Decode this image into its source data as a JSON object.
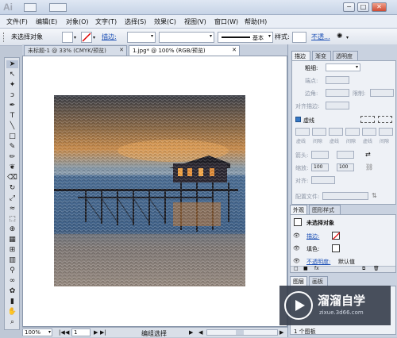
{
  "app": {
    "logo": "Ai"
  },
  "window_controls": {
    "minimize": "−",
    "maximize": "□",
    "close": "✕"
  },
  "menu": [
    "文件(F)",
    "编辑(E)",
    "对象(O)",
    "文字(T)",
    "选择(S)",
    "效果(C)",
    "视图(V)",
    "窗口(W)",
    "帮助(H)"
  ],
  "control_bar": {
    "selection_label": "未选择对象",
    "stroke_link": "描边:",
    "stroke_style": "基本",
    "style_label": "样式:",
    "opacity_link": "不透..."
  },
  "doc_tabs": [
    {
      "label": "未标题-1 @ 33% (CMYK/预览)",
      "close": "✕"
    },
    {
      "label": "1.jpg* @ 100% (RGB/预览)",
      "close": "✕"
    }
  ],
  "status": {
    "zoom": "100%",
    "page": "1",
    "tool": "编组选择"
  },
  "stroke_panel": {
    "tabs": [
      "描边",
      "渐变",
      "透明度"
    ],
    "weight_label": "粗细:",
    "cap_label": "端点:",
    "corner_label": "边角:",
    "limit_label": "限制:",
    "align_label": "对齐描边:",
    "dashed_label": "虚线",
    "arrow_label": "箭头:",
    "scale_label": "缩放:",
    "scale_start": "100",
    "scale_end": "100",
    "arrow_align_label": "对齐:",
    "profile_label": "配置文件:",
    "dash_inputs": [
      "虚线",
      "间隙",
      "虚线",
      "间隙",
      "虚线",
      "间隙"
    ]
  },
  "appearance_panel": {
    "tabs": [
      "外观",
      "图形样式"
    ],
    "title": "未选择对象",
    "rows": [
      {
        "label": "描边:",
        "is_link": true
      },
      {
        "label": "填色:",
        "is_link": false
      },
      {
        "label": "不透明度:",
        "value": "默认值"
      }
    ]
  },
  "layers_panel": {
    "tabs": [
      "图层",
      "画板"
    ],
    "footer": "1 个图板"
  },
  "watermark": {
    "title": "溜溜自学",
    "url": "zixue.3d66.com"
  },
  "colors": {
    "ui_bg": "#bfc8d6",
    "link": "#1b4fb5",
    "watermark_bg": "#3b4250"
  }
}
